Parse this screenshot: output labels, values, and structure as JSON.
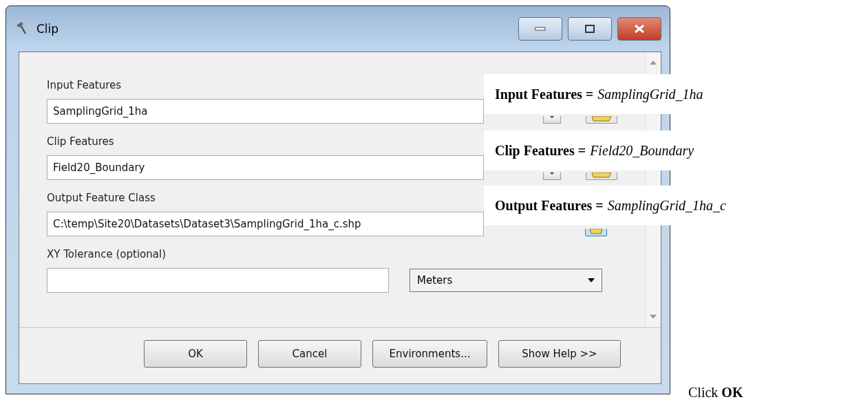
{
  "window": {
    "title": "Clip"
  },
  "fields": [
    {
      "label": "Input Features",
      "value": "SamplingGrid_1ha",
      "kind": "dropdown"
    },
    {
      "label": "Clip Features",
      "value": "Field20_Boundary",
      "kind": "dropdown"
    },
    {
      "label": "Output Feature Class",
      "value": "C:\\temp\\Site20\\Datasets\\Dataset3\\SamplingGrid_1ha_c.shp",
      "kind": "path"
    },
    {
      "label": "XY Tolerance (optional)",
      "kind": "tolerance",
      "unit": "Meters"
    }
  ],
  "buttons": [
    "OK",
    "Cancel",
    "Environments...",
    "Show Help >>"
  ],
  "callouts": [
    {
      "name": "Input Features =",
      "value": "SamplingGrid_1ha"
    },
    {
      "name": "Clip Features =",
      "value": "Field20_Boundary"
    },
    {
      "name": "Output Features =",
      "value": "SamplingGrid_1ha_c"
    }
  ],
  "instruction": "Click **OK**"
}
